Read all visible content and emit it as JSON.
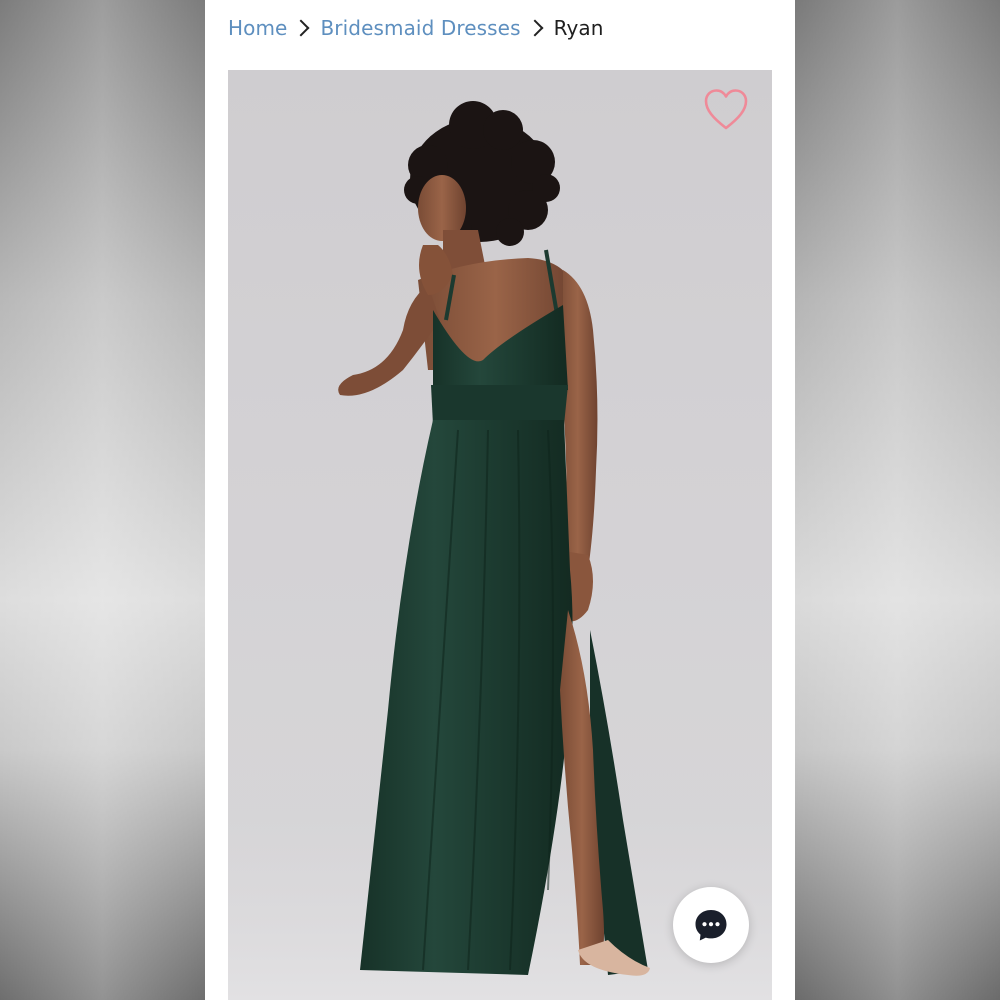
{
  "breadcrumb": {
    "home": "Home",
    "category": "Bridesmaid Dresses",
    "current": "Ryan"
  },
  "icons": {
    "separator": "chevron-right-icon",
    "favorite": "heart-outline-icon",
    "chat": "chat-bubble-icon"
  },
  "colors": {
    "link": "#5e8fbf",
    "heart": "#ef8a98",
    "dress": "#1f3d33",
    "chat_icon": "#1a1f2b"
  }
}
